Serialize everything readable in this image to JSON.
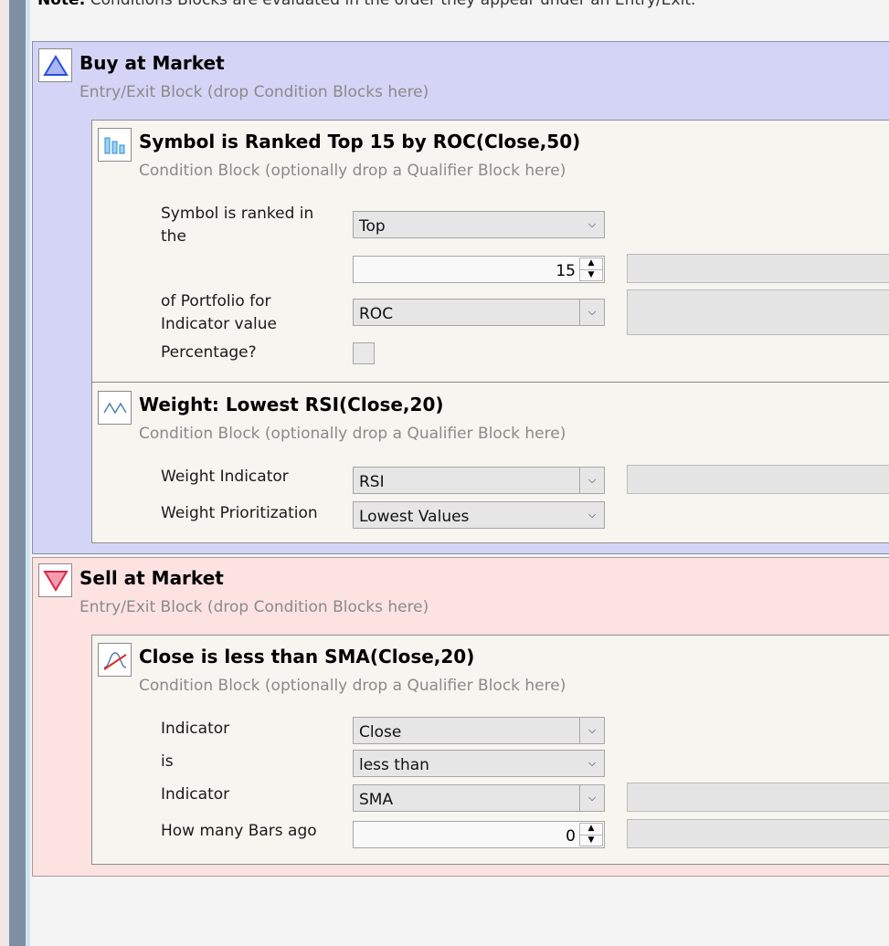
{
  "note": {
    "label": "Note:",
    "text": "Conditions Blocks are evaluated in the order they appear under an Entry/Exit."
  },
  "buy_block": {
    "title": "Buy at Market",
    "subtitle": "Entry/Exit Block (drop Condition Blocks here)",
    "conditions": [
      {
        "title": "Symbol is Ranked Top 15 by ROC(Close,50)",
        "subtitle": "Condition Block (optionally drop a Qualifier Block here)",
        "ranked_label_1": "Symbol is ranked in",
        "ranked_label_2": "the",
        "ranked_value": "Top",
        "count_value": "15",
        "portfolio_label_1": "of Portfolio for",
        "portfolio_label_2": "Indicator value",
        "indicator_value": "ROC",
        "percentage_label": "Percentage?"
      },
      {
        "title": "Weight: Lowest RSI(Close,20)",
        "subtitle": "Condition Block (optionally drop a Qualifier Block here)",
        "weight_indicator_label": "Weight Indicator",
        "weight_indicator_value": "RSI",
        "weight_prior_label": "Weight Prioritization",
        "weight_prior_value": "Lowest Values"
      }
    ]
  },
  "sell_block": {
    "title": "Sell at Market",
    "subtitle": "Entry/Exit Block (drop Condition Blocks here)",
    "condition": {
      "title": "Close is less than SMA(Close,20)",
      "subtitle": "Condition Block (optionally drop a Qualifier Block here)",
      "indicator1_label": "Indicator",
      "indicator1_value": "Close",
      "is_label": "is",
      "is_value": "less than",
      "indicator2_label": "Indicator",
      "indicator2_value": "SMA",
      "bars_ago_label": "How many Bars ago",
      "bars_ago_value": "0"
    }
  },
  "icons": {
    "buy": "triangle-up-icon",
    "sell": "triangle-down-icon",
    "rank": "bar-chart-icon",
    "weight": "wave-icon",
    "cross": "crossover-icon",
    "dropdown": "chevron-down-icon"
  },
  "colors": {
    "buy_bg": "#d4d4f6",
    "sell_bg": "#fde2e2",
    "condition_bg": "#f7f5f0"
  }
}
